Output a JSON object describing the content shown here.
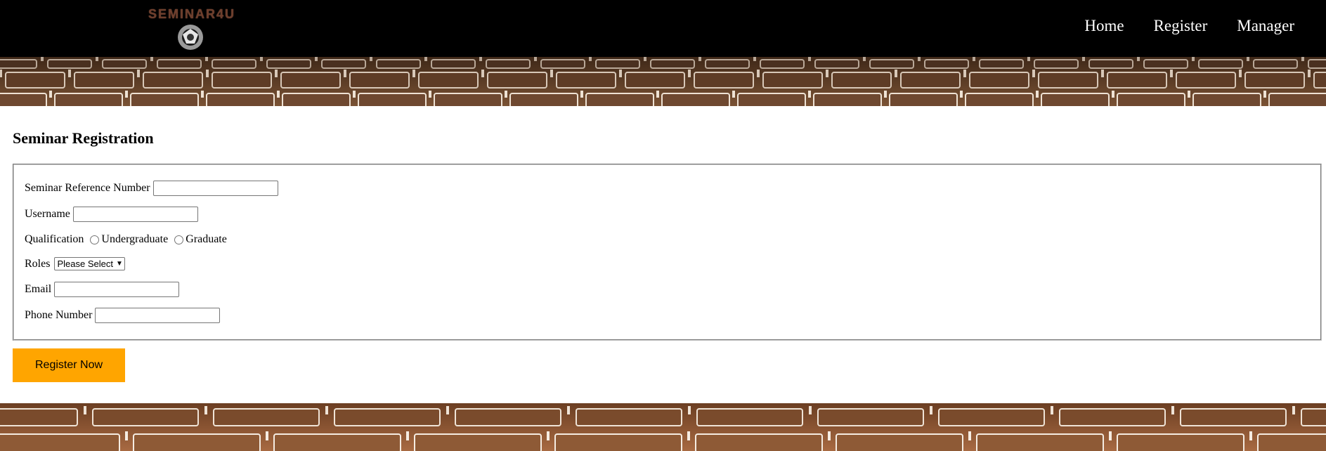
{
  "header": {
    "logo_text": "SEMINAR4U",
    "nav": [
      "Home",
      "Register",
      "Manager"
    ]
  },
  "main": {
    "title": "Seminar Registration",
    "fields": {
      "ref_label": "Seminar Reference Number",
      "ref_value": "",
      "username_label": "Username",
      "username_value": "",
      "qualification_label": "Qualification",
      "qualification_options": [
        "Undergraduate",
        "Graduate"
      ],
      "roles_label": "Roles",
      "roles_selected": "Please Select",
      "email_label": "Email",
      "email_value": "",
      "phone_label": "Phone Number",
      "phone_value": ""
    },
    "submit_label": "Register Now"
  },
  "colors": {
    "header_bg": "#000000",
    "button_bg": "#ffa500",
    "nav_text": "#ffffff"
  }
}
